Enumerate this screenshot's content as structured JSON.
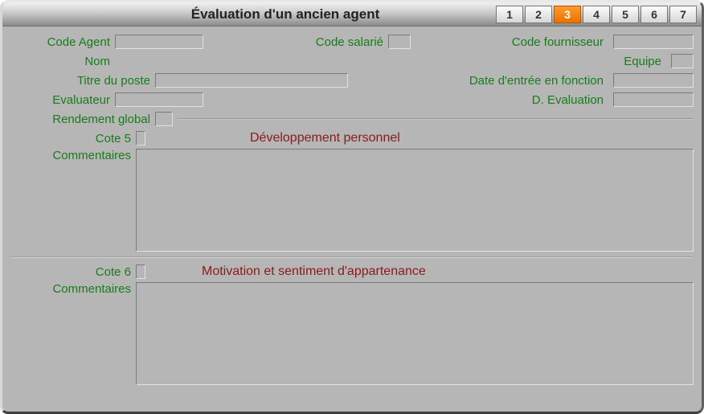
{
  "window": {
    "title": "Évaluation d'un ancien agent"
  },
  "pager": {
    "buttons": [
      "1",
      "2",
      "3",
      "4",
      "5",
      "6",
      "7"
    ],
    "active": "3"
  },
  "labels": {
    "code_agent": "Code Agent",
    "code_salarie": "Code salarié",
    "code_fournisseur": "Code fournisseur",
    "nom": "Nom",
    "equipe": "Equipe",
    "titre_poste": "Titre du poste",
    "date_entree": "Date d'entrée en fonction",
    "evaluateur": "Evaluateur",
    "d_evaluation": "D. Evaluation",
    "rendement": "Rendement global",
    "cote5": "Cote 5",
    "cote6": "Cote 6",
    "commentaires": "Commentaires"
  },
  "sections": {
    "dev_personnel": "Développement personnel",
    "motivation": "Motivation et sentiment d'appartenance"
  },
  "fields": {
    "code_agent": "",
    "code_salarie": "",
    "code_fournisseur": "",
    "nom": "",
    "equipe": "",
    "titre_poste": "",
    "date_entree": "",
    "evaluateur": "",
    "d_evaluation": "",
    "rendement": "",
    "cote5": "",
    "cote6": "",
    "commentaires5": "",
    "commentaires6": ""
  }
}
